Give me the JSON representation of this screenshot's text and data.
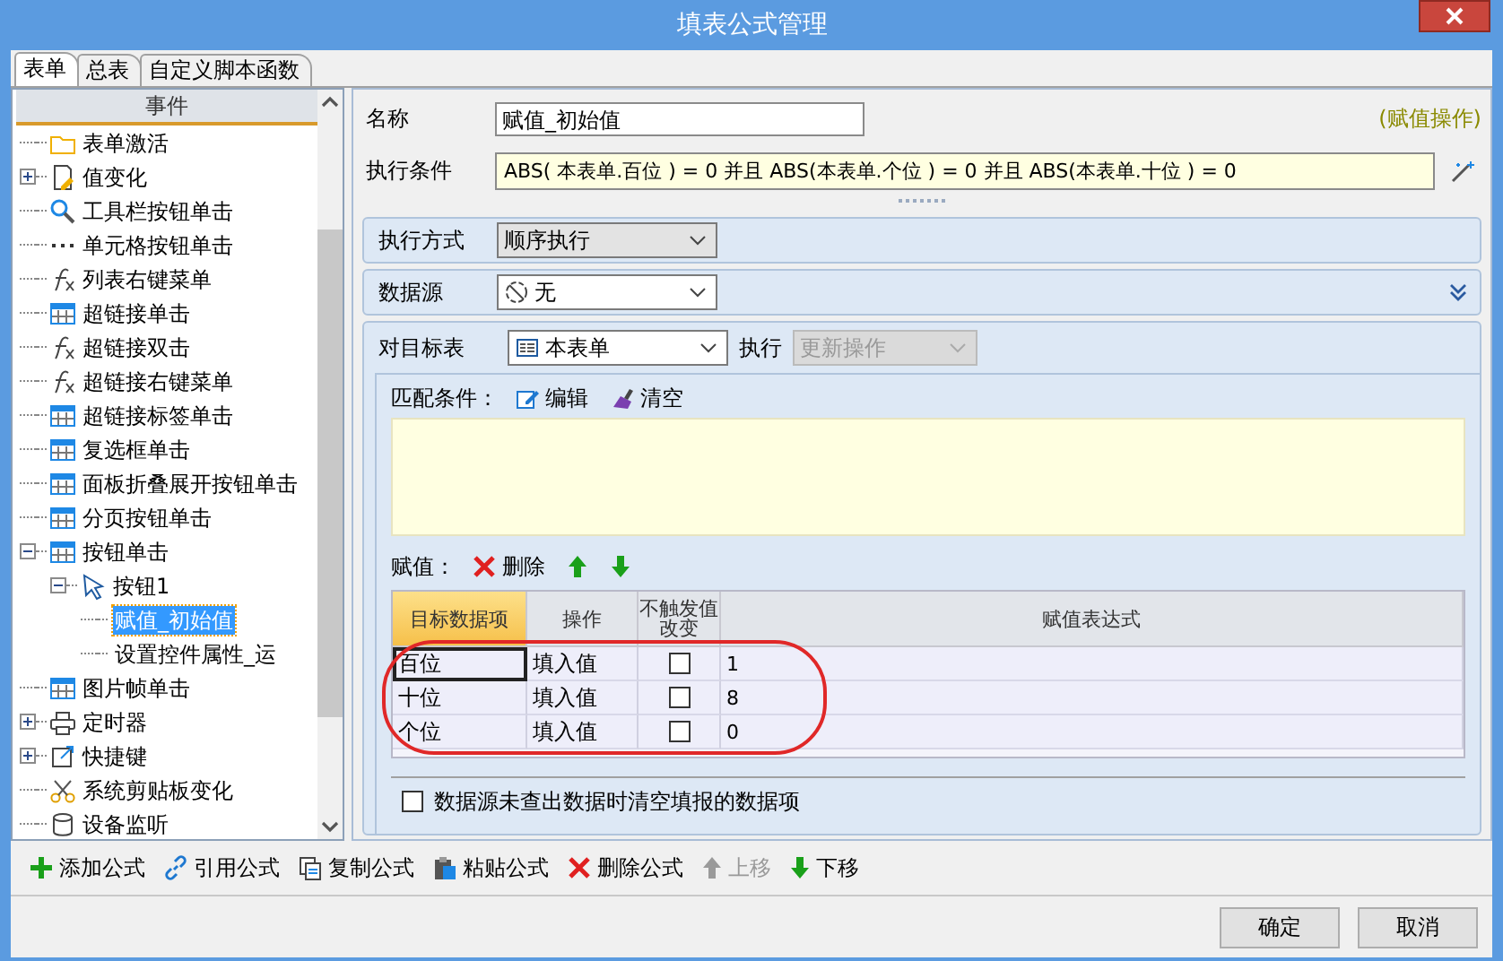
{
  "window": {
    "title": "填表公式管理"
  },
  "tabs": [
    {
      "label": "表单",
      "selected": true
    },
    {
      "label": "总表",
      "selected": false
    },
    {
      "label": "自定义脚本函数",
      "selected": false
    }
  ],
  "event_tree": {
    "header": "事件",
    "items": [
      {
        "kind": "folder",
        "label": "表单激活",
        "selected": false
      },
      {
        "kind": "value",
        "label": "值变化",
        "selected": false,
        "expanded": false
      },
      {
        "kind": "tool",
        "label": "工具栏按钮单击",
        "selected": false
      },
      {
        "kind": "dots",
        "label": "单元格按钮单击",
        "selected": false
      },
      {
        "kind": "fx",
        "label": "列表右键菜单",
        "selected": false
      },
      {
        "kind": "grid",
        "label": "超链接单击",
        "selected": false
      },
      {
        "kind": "fx",
        "label": "超链接双击",
        "selected": false
      },
      {
        "kind": "fx",
        "label": "超链接右键菜单",
        "selected": false
      },
      {
        "kind": "grid",
        "label": "超链接标签单击",
        "selected": false
      },
      {
        "kind": "grid",
        "label": "复选框单击",
        "selected": false
      },
      {
        "kind": "grid",
        "label": "面板折叠展开按钮单击",
        "selected": false
      },
      {
        "kind": "grid",
        "label": "分页按钮单击",
        "selected": false
      },
      {
        "kind": "grid",
        "label": "按钮单击",
        "selected": false,
        "expanded": true,
        "children": [
          {
            "kind": "cursor",
            "label": "按钮1",
            "selected": false,
            "expanded": true,
            "children": [
              {
                "label": "赋值_初始值",
                "selected": true
              },
              {
                "label": "设置控件属性_运",
                "selected": false
              }
            ]
          }
        ]
      },
      {
        "kind": "grid",
        "label": "图片帧单击",
        "selected": false
      },
      {
        "kind": "timer",
        "label": "定时器",
        "selected": false,
        "expanded": false
      },
      {
        "kind": "shortcut",
        "label": "快捷键",
        "selected": false,
        "expanded": false
      },
      {
        "kind": "clipboard",
        "label": "系统剪贴板变化",
        "selected": false
      },
      {
        "kind": "device",
        "label": "设备监听",
        "selected": false
      }
    ]
  },
  "formula": {
    "name_label": "名称",
    "name_value": "赋值_初始值",
    "type_label": "(赋值操作)",
    "condition_label": "执行条件",
    "condition_value": "ABS( 本表单.百位 ) = 0 并且  ABS(本表单.个位 ) = 0 并且  ABS(本表单.十位 ) = 0"
  },
  "execution_mode": {
    "label": "执行方式",
    "value": "顺序执行"
  },
  "data_source": {
    "label": "数据源",
    "value": "无"
  },
  "target": {
    "label": "对目标表",
    "value": "本表单",
    "action_label": "执行",
    "action_value": "更新操作",
    "action_disabled": true
  },
  "match": {
    "label": "匹配条件：",
    "buttons": [
      {
        "kind": "edit",
        "label": "编辑"
      },
      {
        "kind": "clear",
        "label": "清空"
      }
    ]
  },
  "assign": {
    "label": "赋值：",
    "buttons": [
      {
        "kind": "delete",
        "label": "删除"
      },
      {
        "kind": "up"
      },
      {
        "kind": "down"
      }
    ],
    "columns": [
      {
        "label": "目标数据项",
        "selected": true
      },
      {
        "label": "操作",
        "selected": false
      },
      {
        "label": "不触发值改变",
        "selected": false
      },
      {
        "label": "赋值表达式",
        "selected": false
      }
    ],
    "rows": [
      {
        "target": "百位",
        "operation": "填入值",
        "no_trigger": false,
        "expression": "1",
        "active": true
      },
      {
        "target": "十位",
        "operation": "填入值",
        "no_trigger": false,
        "expression": "8",
        "active": false
      },
      {
        "target": "个位",
        "operation": "填入值",
        "no_trigger": false,
        "expression": "0",
        "active": false
      }
    ]
  },
  "clear_option": {
    "label": "数据源未查出数据时清空填报的数据项",
    "checked": false
  },
  "toolbar": [
    {
      "kind": "add",
      "label": "添加公式",
      "disabled": false
    },
    {
      "kind": "link",
      "label": "引用公式",
      "disabled": false
    },
    {
      "kind": "copy",
      "label": "复制公式",
      "disabled": false
    },
    {
      "kind": "paste",
      "label": "粘贴公式",
      "disabled": false
    },
    {
      "kind": "delete",
      "label": "删除公式",
      "disabled": false
    },
    {
      "kind": "up",
      "label": "上移",
      "disabled": true
    },
    {
      "kind": "down",
      "label": "下移",
      "disabled": false
    }
  ],
  "footer": {
    "buttons": [
      "确定",
      "取消"
    ]
  }
}
